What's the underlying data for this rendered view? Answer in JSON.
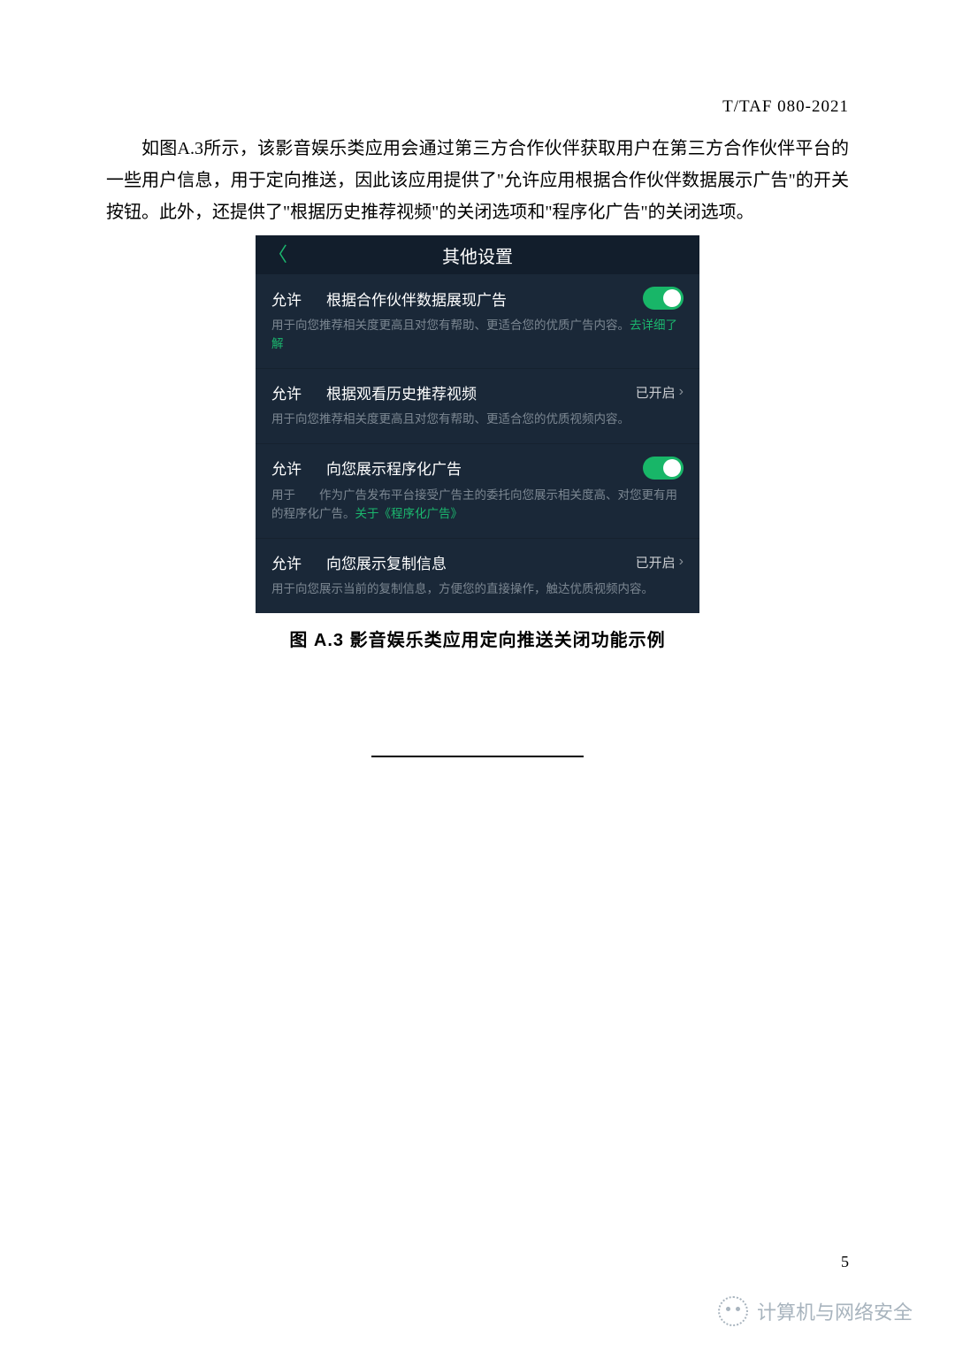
{
  "doc": {
    "code": "T/TAF 080-2021",
    "paragraph": "如图A.3所示，该影音娱乐类应用会通过第三方合作伙伴获取用户在第三方合作伙伴平台的一些用户信息，用于定向推送，因此该应用提供了\"允许应用根据合作伙伴数据展示广告\"的开关按钮。此外，还提供了\"根据历史推荐视频\"的关闭选项和\"程序化广告\"的关闭选项。",
    "figure_caption": "图 A.3 影音娱乐类应用定向推送关闭功能示例",
    "page_number": "5",
    "watermark": "计算机与网络安全"
  },
  "screenshot": {
    "header_title": "其他设置",
    "items": [
      {
        "allow": "允许",
        "title": "根据合作伙伴数据展现广告",
        "control": "toggle_on",
        "desc_pre": "用于向您推荐相关度更高且对您有帮助、更适合您的优质广告内容。",
        "desc_link": "去详细了解",
        "desc_post": ""
      },
      {
        "allow": "允许",
        "title": "根据观看历史推荐视频",
        "control": "status",
        "status_text": "已开启",
        "desc_pre": "用于向您推荐相关度更高且对您有帮助、更适合您的优质视频内容。",
        "desc_link": "",
        "desc_post": ""
      },
      {
        "allow": "允许",
        "title": "向您展示程序化广告",
        "control": "toggle_on",
        "desc_pre": "用于  作为广告发布平台接受广告主的委托向您展示相关度高、对您更有用的程序化广告。",
        "desc_link": "关于《程序化广告》",
        "desc_post": ""
      },
      {
        "allow": "允许",
        "title": "向您展示复制信息",
        "control": "status",
        "status_text": "已开启",
        "desc_pre": "用于向您展示当前的复制信息，方便您的直接操作，触达优质视频内容。",
        "desc_link": "",
        "desc_post": ""
      }
    ]
  }
}
